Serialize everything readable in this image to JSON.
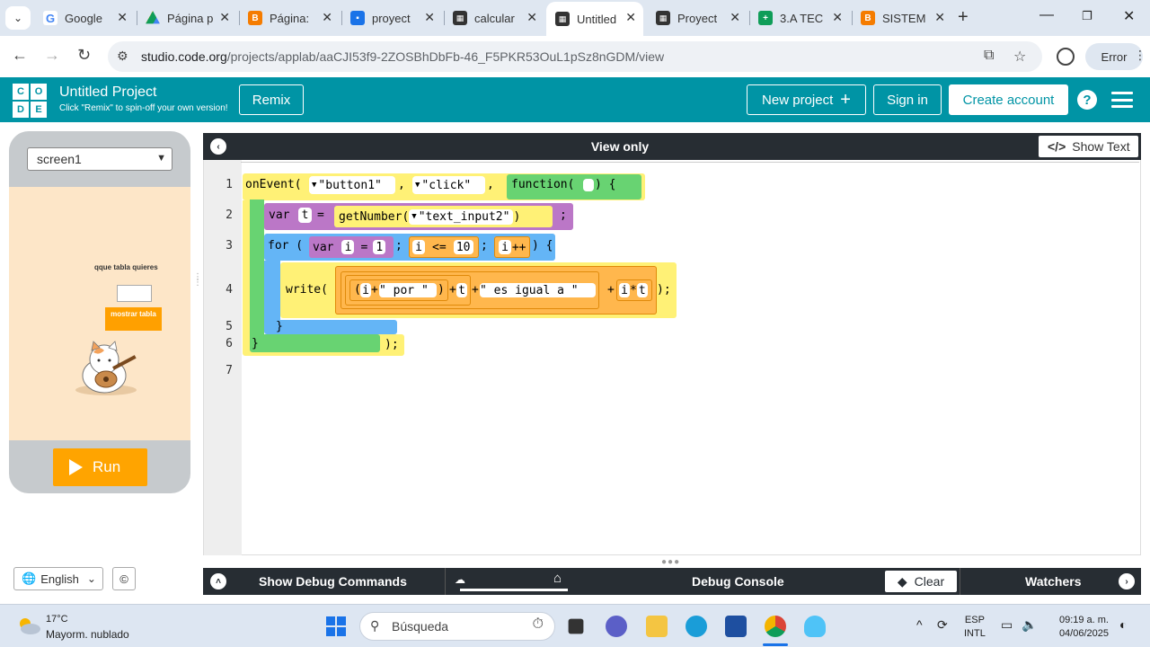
{
  "browser": {
    "tabs": [
      {
        "label": "Google",
        "favicon": "google-icon",
        "color": "#4285f4"
      },
      {
        "label": "Página p",
        "favicon": "drive-icon",
        "color": "#0f9d58"
      },
      {
        "label": "Página:",
        "favicon": "blogger-icon",
        "color": "#f57c00"
      },
      {
        "label": "proyect",
        "favicon": "contact-card-icon",
        "color": "#1a73e8"
      },
      {
        "label": "calcular",
        "favicon": "codeorg-icon",
        "color": "#333333"
      },
      {
        "label": "Untitled",
        "favicon": "codeorg-icon",
        "color": "#333333",
        "active": true
      },
      {
        "label": "Proyect",
        "favicon": "codeorg-icon",
        "color": "#333333"
      },
      {
        "label": "3.A TEC",
        "favicon": "sheets-icon",
        "color": "#0f9d58"
      },
      {
        "label": "SISTEM",
        "favicon": "blogger-icon",
        "color": "#f57c00"
      }
    ],
    "url_host": "studio.code.org",
    "url_path": "/projects/applab/aaCJI53f9-2ZOSBhDbFb-46_F5PKR53OuL1pSz8nGDM/view",
    "error_label": "Error"
  },
  "header": {
    "logo": [
      "C",
      "O",
      "D",
      "E"
    ],
    "title": "Untitled Project",
    "subtitle": "Click \"Remix\" to spin-off your own version!",
    "remix": "Remix",
    "new_project": "New project",
    "sign_in": "Sign in",
    "create_account": "Create account",
    "help": "?"
  },
  "app": {
    "screen_select": "screen1",
    "label": "qque tabla quieres",
    "button": "mostrar tabla",
    "run": "Run"
  },
  "footer": {
    "language": "English",
    "copyright": "©"
  },
  "editor": {
    "title": "View only",
    "show_text": "Show Text",
    "line_numbers": [
      "1",
      "2",
      "3",
      "4",
      "5",
      "6",
      "7"
    ],
    "code": {
      "onEvent": "onEvent(",
      "button_id": "\"button1\"",
      "comma1": ",",
      "event": "\"click\"",
      "comma2": ",",
      "function_kw": "function(",
      "function_close": ") {",
      "var_kw": "var",
      "var_name": "t",
      "eq": "=",
      "getNumber": "getNumber(",
      "input_id": "\"text_input2\"",
      "close_paren": ")",
      "semicolon": ";",
      "for_kw": "for (",
      "for_var": "var",
      "for_i": "i",
      "for_eq": "=",
      "for_init": "1",
      "for_semi1": ";",
      "cond_i": "i",
      "cond_op": "<=",
      "cond_val": "10",
      "for_semi2": ";",
      "inc": "i++",
      "for_close": ") {",
      "write_kw": "write(",
      "w_open": "(",
      "w_i": "i",
      "w_plus1": "+",
      "w_por": "\" por \"",
      "w_close1": ")",
      "w_plus2": "+",
      "w_t": "t",
      "w_plus3": "+",
      "w_igual": "\" es igual a \"",
      "w_plus4": "+",
      "w_i2": "i",
      "w_mul": "*",
      "w_t2": "t",
      "w_end": ");",
      "for_end": "}",
      "fn_end": "}",
      "event_end": ");"
    }
  },
  "debug": {
    "show_debug": "Show Debug Commands",
    "console": "Debug Console",
    "clear": "Clear",
    "watchers": "Watchers"
  },
  "taskbar": {
    "temperature": "17°C",
    "weather": "Mayorm. nublado",
    "search": "Búsqueda",
    "lang1": "ESP",
    "lang2": "INTL",
    "time": "09:19 a. m.",
    "date": "04/06/2025"
  }
}
